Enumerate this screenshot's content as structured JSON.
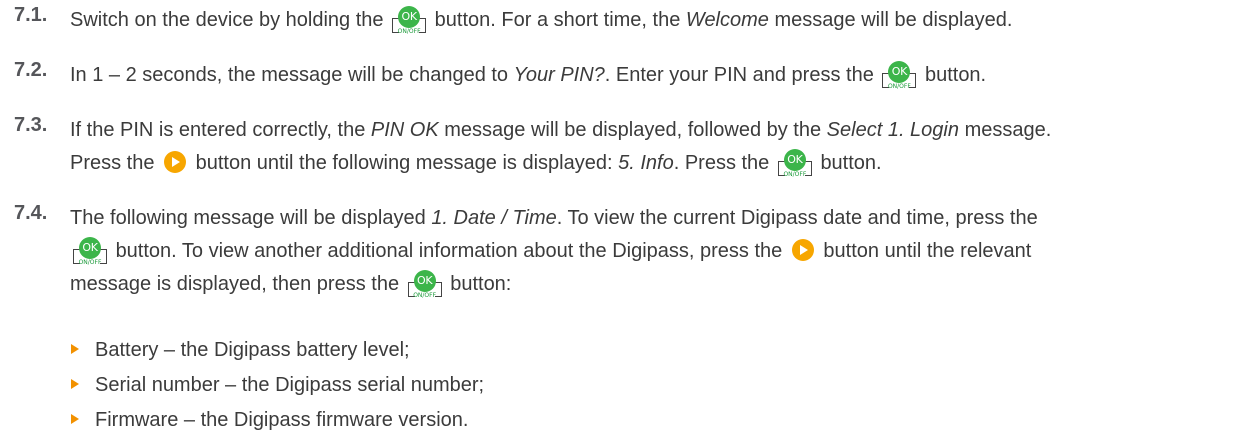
{
  "ok_button": {
    "label": "OK",
    "sublabel": "ON/OFF",
    "color": "#3cb54a"
  },
  "arrow_button": {
    "color": "#f7a600"
  },
  "steps": [
    {
      "number": "7.1.",
      "a": "Switch on the device by holding the",
      "b": "button. For a short time, the",
      "c": "Welcome",
      "d": "message will be displayed."
    },
    {
      "number": "7.2.",
      "a": "In 1 – 2 seconds, the message will be changed to",
      "b": "Your PIN?",
      "c": ". Enter your PIN and press the",
      "d": "button."
    },
    {
      "number": "7.3.",
      "a": "If the PIN is entered correctly, the",
      "b": "PIN OK",
      "c": "message will be displayed, followed by the",
      "d": "Select 1. Login",
      "e": "message.",
      "f": "Press the",
      "g": "button until the following message is displayed:",
      "h": "5. Info",
      "i": ". Press the",
      "j": "button."
    },
    {
      "number": "7.4.",
      "a": "The following message will be displayed",
      "b": "1. Date / Time",
      "c": ". To view the current Digipass date and time, press the",
      "d": "button. To view another additional information about the Digipass, press the",
      "e": "button until the relevant",
      "f": "message is displayed, then press the",
      "g": "button:"
    }
  ],
  "bullets": [
    "Battery – the Digipass battery level;",
    "Serial number – the Digipass serial number;",
    "Firmware – the Digipass firmware version."
  ]
}
